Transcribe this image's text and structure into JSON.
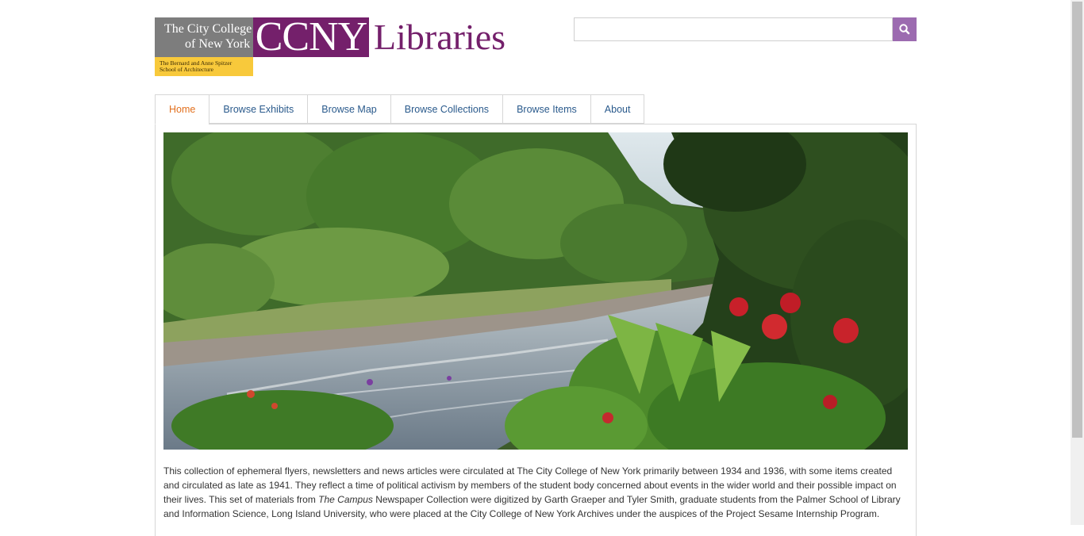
{
  "logo": {
    "college_line1": "The City College",
    "college_line2": "of New York",
    "school_line1": "The Bernard and Anne Spitzer",
    "school_line2": "School of Architecture",
    "ccny": "CCNY",
    "libraries": "Libraries",
    "colors": {
      "purple": "#74206b",
      "gray": "#7d7d7d",
      "yellow": "#f8c93b"
    }
  },
  "search": {
    "value": "",
    "placeholder": "",
    "button_icon": "search-icon",
    "button_color": "#9c6bb0"
  },
  "nav": {
    "tabs": [
      {
        "label": "Home",
        "active": true
      },
      {
        "label": "Browse Exhibits",
        "active": false
      },
      {
        "label": "Browse Map",
        "active": false
      },
      {
        "label": "Browse Collections",
        "active": false
      },
      {
        "label": "Browse Items",
        "active": false
      },
      {
        "label": "About",
        "active": false
      }
    ],
    "active_color": "#e2701e",
    "link_color": "#2a5a8c"
  },
  "hero": {
    "scene": "tropical river with rocky banks, dense green forest and red flowers"
  },
  "description": {
    "part1": "This collection of ephemeral flyers, newsletters and news articles were circulated at The City College of New York primarily between 1934 and 1936, with some items created and circulated as late as 1941. They reflect a time of political activism by members of the student body concerned about events in the wider world and their possible impact on their lives. This set of materials from ",
    "italic": "The Campus",
    "part2": " Newspaper Collection were digitized by Garth Graeper and Tyler Smith, graduate students from the Palmer School of Library and Information Science, Long Island University, who were placed at the City College of New York Archives under the auspices of the Project Sesame Internship Program."
  }
}
